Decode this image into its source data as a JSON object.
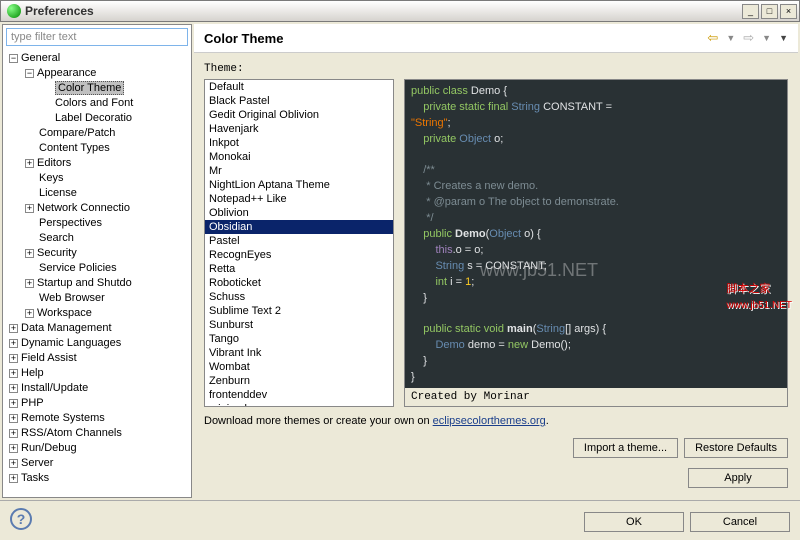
{
  "window": {
    "title": "Preferences",
    "filter_placeholder": "type filter text"
  },
  "header": {
    "title": "Color Theme"
  },
  "tree": [
    {
      "d": 0,
      "e": "−",
      "l": "General"
    },
    {
      "d": 1,
      "e": "−",
      "l": "Appearance"
    },
    {
      "d": 2,
      "e": "",
      "l": "Color Theme",
      "sel": true
    },
    {
      "d": 2,
      "e": "",
      "l": "Colors and Font"
    },
    {
      "d": 2,
      "e": "",
      "l": "Label Decoratio"
    },
    {
      "d": 1,
      "e": "",
      "l": "Compare/Patch"
    },
    {
      "d": 1,
      "e": "",
      "l": "Content Types"
    },
    {
      "d": 1,
      "e": "+",
      "l": "Editors"
    },
    {
      "d": 1,
      "e": "",
      "l": "Keys"
    },
    {
      "d": 1,
      "e": "",
      "l": "License"
    },
    {
      "d": 1,
      "e": "+",
      "l": "Network Connectio"
    },
    {
      "d": 1,
      "e": "",
      "l": "Perspectives"
    },
    {
      "d": 1,
      "e": "",
      "l": "Search"
    },
    {
      "d": 1,
      "e": "+",
      "l": "Security"
    },
    {
      "d": 1,
      "e": "",
      "l": "Service Policies"
    },
    {
      "d": 1,
      "e": "+",
      "l": "Startup and Shutdo"
    },
    {
      "d": 1,
      "e": "",
      "l": "Web Browser"
    },
    {
      "d": 1,
      "e": "+",
      "l": "Workspace"
    },
    {
      "d": 0,
      "e": "+",
      "l": "Data Management"
    },
    {
      "d": 0,
      "e": "+",
      "l": "Dynamic Languages"
    },
    {
      "d": 0,
      "e": "+",
      "l": "Field Assist"
    },
    {
      "d": 0,
      "e": "+",
      "l": "Help"
    },
    {
      "d": 0,
      "e": "+",
      "l": "Install/Update"
    },
    {
      "d": 0,
      "e": "+",
      "l": "PHP"
    },
    {
      "d": 0,
      "e": "+",
      "l": "Remote Systems"
    },
    {
      "d": 0,
      "e": "+",
      "l": "RSS/Atom Channels"
    },
    {
      "d": 0,
      "e": "+",
      "l": "Run/Debug"
    },
    {
      "d": 0,
      "e": "+",
      "l": "Server"
    },
    {
      "d": 0,
      "e": "+",
      "l": "Tasks"
    }
  ],
  "theme_label": "Theme:",
  "themes": [
    "Default",
    "Black Pastel",
    "Gedit Original Oblivion",
    "Havenjark",
    "Inkpot",
    "Monokai",
    "Mr",
    "NightLion Aptana Theme",
    "Notepad++ Like",
    "Oblivion",
    "Obsidian",
    "Pastel",
    "RecognEyes",
    "Retta",
    "Roboticket",
    "Schuss",
    "Sublime Text 2",
    "Sunburst",
    "Tango",
    "Vibrant Ink",
    "Wombat",
    "Zenburn",
    "frontenddev",
    "minimal"
  ],
  "selected_theme": "Obsidian",
  "credit": "Created by Morinar",
  "download": {
    "pre": "Download more themes or create your own on ",
    "link": "eclipsecolorthemes.org",
    "post": "."
  },
  "buttons": {
    "import": "Import a theme...",
    "restore": "Restore Defaults",
    "apply": "Apply",
    "ok": "OK",
    "cancel": "Cancel"
  },
  "code": {
    "l1a": "public class ",
    "l1b": "Demo",
    "l1c": " {",
    "l2a": "    private static final ",
    "l2b": "String",
    "l2c": " CONSTANT = ",
    "l3": "\"String\"",
    "l3b": ";",
    "l4a": "    private ",
    "l4b": "Object",
    "l4c": " o;",
    "l6": "    /**",
    "l7": "     * Creates a new demo.",
    "l8a": "     * ",
    "l8b": "@param",
    "l8c": " o The object to demonstrate.",
    "l9": "     */",
    "l10a": "    public ",
    "l10b": "Demo",
    "l10c": "(",
    "l10d": "Object",
    "l10e": " o) {",
    "l11a": "        this",
    "l11b": ".o = o;",
    "l12a": "        String",
    "l12b": " s = CONSTANT;",
    "l13a": "        int",
    "l13b": " i = ",
    "l13c": "1",
    "l13d": ";",
    "l14": "    }",
    "l16a": "    public static void ",
    "l16b": "main",
    "l16c": "(",
    "l16d": "String",
    "l16e": "[] args) {",
    "l17a": "        Demo",
    "l17b": " demo = ",
    "l17c": "new ",
    "l17d": "Demo",
    "l17e": "();",
    "l18": "    }",
    "l19": "}"
  },
  "watermark": "www.jb51.NET",
  "watermark2": "脚本之家"
}
